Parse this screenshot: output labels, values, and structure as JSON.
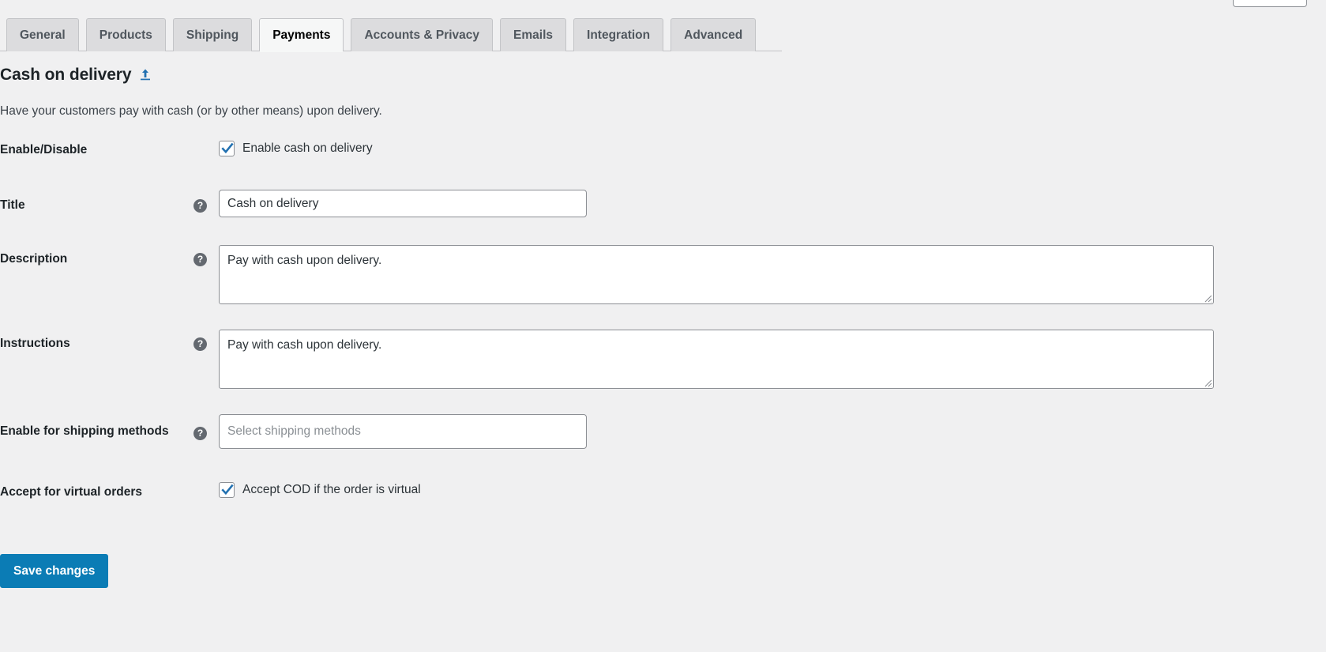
{
  "top_search": {
    "value": ""
  },
  "tabs": [
    {
      "label": "General",
      "active": false
    },
    {
      "label": "Products",
      "active": false
    },
    {
      "label": "Shipping",
      "active": false
    },
    {
      "label": "Payments",
      "active": true
    },
    {
      "label": "Accounts & Privacy",
      "active": false
    },
    {
      "label": "Emails",
      "active": false
    },
    {
      "label": "Integration",
      "active": false
    },
    {
      "label": "Advanced",
      "active": false
    }
  ],
  "section": {
    "title": "Cash on delivery",
    "back_icon": "arrow-up-from-line-icon",
    "description": "Have your customers pay with cash (or by other means) upon delivery."
  },
  "form": {
    "enable_disable": {
      "label": "Enable/Disable",
      "checkbox_label": "Enable cash on delivery",
      "checked": true
    },
    "title": {
      "label": "Title",
      "help_icon": "help-icon",
      "value": "Cash on delivery",
      "placeholder": ""
    },
    "description": {
      "label": "Description",
      "help_icon": "help-icon",
      "value": "Pay with cash upon delivery.",
      "placeholder": ""
    },
    "instructions": {
      "label": "Instructions",
      "help_icon": "help-icon",
      "value": "Pay with cash upon delivery.",
      "placeholder": ""
    },
    "shipping_methods": {
      "label": "Enable for shipping methods",
      "help_icon": "help-icon",
      "value": "",
      "placeholder": "Select shipping methods"
    },
    "virtual_orders": {
      "label": "Accept for virtual orders",
      "checkbox_label": "Accept COD if the order is virtual",
      "checked": true
    }
  },
  "actions": {
    "save_label": "Save changes"
  },
  "colors": {
    "page_background": "#f0f0f1",
    "tab_inactive": "#dcdcde",
    "tab_active": "#f6f7f7",
    "accent_blue": "#2271b1",
    "primary_button": "#0b7cb5",
    "border": "#8c8f94",
    "text": "#1d2327"
  }
}
